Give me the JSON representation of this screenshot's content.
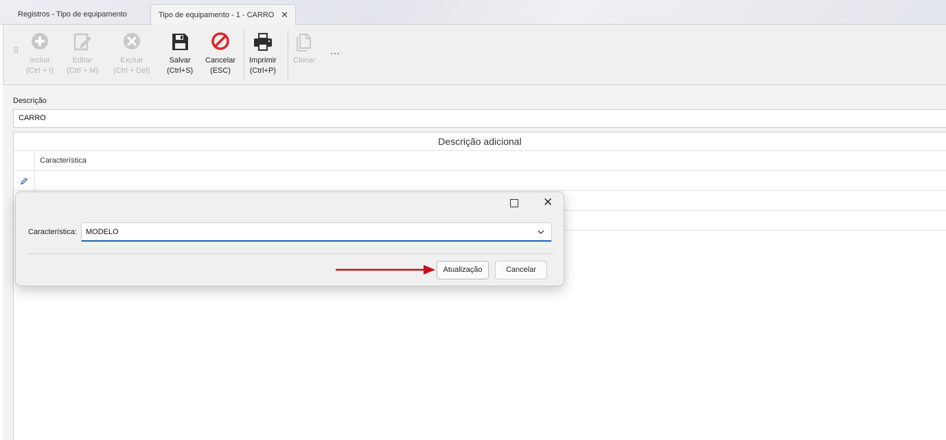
{
  "tabs": [
    {
      "label": "Registros - Tipo de equipamento",
      "active": false
    },
    {
      "label": "Tipo de equipamento - 1 - CARRO",
      "active": true
    }
  ],
  "toolbar": {
    "buttons": [
      {
        "line1": "Incluir",
        "line2": "(Ctrl + I)",
        "enabled": false,
        "icon": "plus-circle-icon"
      },
      {
        "line1": "Editar",
        "line2": "(Ctrl + M)",
        "enabled": false,
        "icon": "edit-icon"
      },
      {
        "line1": "Excluir",
        "line2": "(Ctrl + Del)",
        "enabled": false,
        "icon": "x-circle-icon"
      },
      {
        "line1": "Salvar",
        "line2": "(Ctrl+S)",
        "enabled": true,
        "icon": "save-icon"
      },
      {
        "line1": "Cancelar",
        "line2": "(ESC)",
        "enabled": true,
        "icon": "cancel-icon"
      },
      {
        "line1": "Imprimir",
        "line2": "(Ctrl+P)",
        "enabled": true,
        "icon": "printer-icon"
      },
      {
        "line1": "Clonar",
        "line2": "",
        "enabled": false,
        "icon": "clone-icon"
      }
    ],
    "more": "..."
  },
  "form": {
    "descricao_label": "Descrição",
    "descricao_value": "CARRO"
  },
  "grid": {
    "title": "Descrição adicional",
    "columns": [
      "Característica"
    ],
    "rows": [
      {
        "caracteristica": "",
        "editing": true
      },
      {
        "caracteristica": "",
        "editing": false
      },
      {
        "caracteristica": "",
        "editing": false
      }
    ]
  },
  "dialog": {
    "field_label": "Característica:",
    "field_value": "MODELO",
    "update_label": "Atualização",
    "cancel_label": "Cancelar"
  },
  "colors": {
    "accent_blue": "#1a5fb4",
    "cancel_red": "#e0242c",
    "arrow_red": "#c0141c",
    "disabled": "#b3b3b3"
  }
}
